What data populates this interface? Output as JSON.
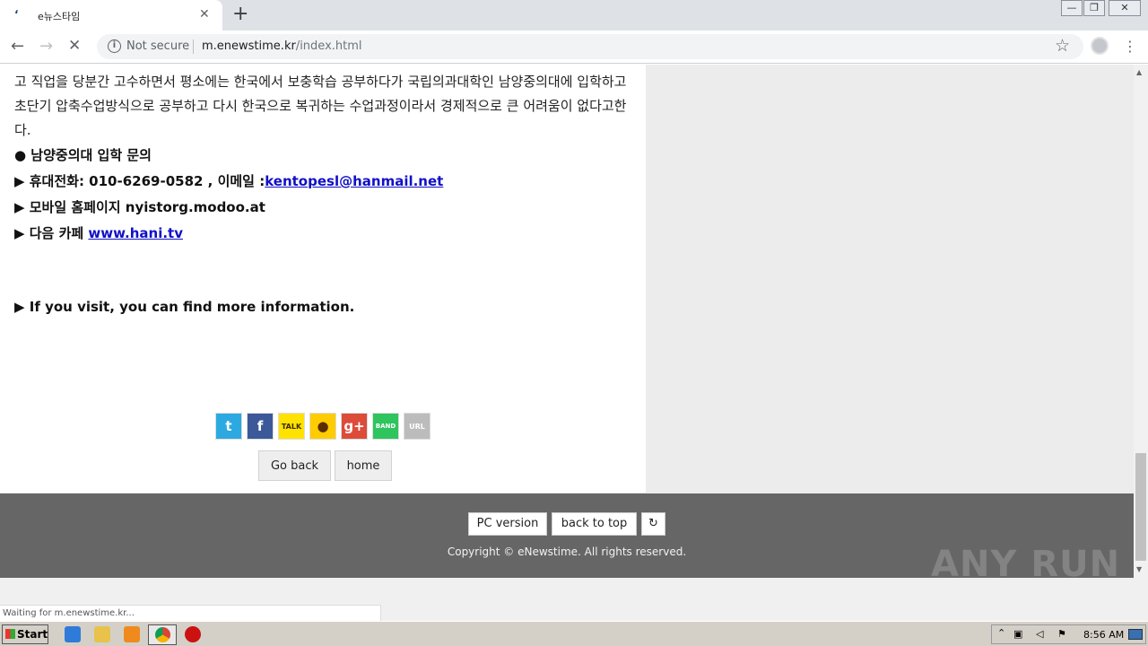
{
  "browser": {
    "tab_title": "e뉴스타임",
    "tab_close": "✕",
    "new_tab": "+",
    "security_label": "Not secure",
    "url_host": "m.enewstime.kr",
    "url_path": "/index.html",
    "window_controls": [
      "—",
      "❐",
      "✕"
    ]
  },
  "article": {
    "paragraph": "고 직업을 당분간 고수하면서 평소에는 한국에서 보충학습 공부하다가 국립의과대학인 남양중의대에 입학하고 초단기 압축수업방식으로 공부하고 다시 한국으로 복귀하는 수업과정이라서 경제적으로 큰 어려움이 없다고한다.",
    "heading": "● 남양중의대 입학 문의",
    "phone_line": "▶ 휴대전화: 010-6269-0582 , 이메일 :",
    "email": "kentopesl@hanmail.net",
    "mobile_line": "▶ 모바일 홈페이지 nyistorg.modoo.at",
    "cafe_label": "▶ 다음 카페 ",
    "cafe_link": "www.hani.tv",
    "visit_line": "▶ If you visit, you can find more information."
  },
  "share_icons": [
    {
      "name": "twitter-icon",
      "glyph": "t",
      "color": "#2ca9e1"
    },
    {
      "name": "facebook-icon",
      "glyph": "f",
      "color": "#3b5998"
    },
    {
      "name": "kakaotalk-icon",
      "glyph": "TALK",
      "color": "#ffe200"
    },
    {
      "name": "kakaostory-icon",
      "glyph": "●",
      "color": "#ffcc00"
    },
    {
      "name": "googleplus-icon",
      "glyph": "g+",
      "color": "#dd4b39"
    },
    {
      "name": "band-icon",
      "glyph": "BAND",
      "color": "#2ec45e"
    },
    {
      "name": "url-copy-icon",
      "glyph": "URL",
      "color": "#bcbcbc"
    }
  ],
  "buttons": {
    "go_back": "Go back",
    "home": "home",
    "pc_version": "PC version",
    "back_to_top": "back to top",
    "refresh": "↻"
  },
  "footer": {
    "copyright": "Copyright © eNewstime. All rights reserved."
  },
  "status_text": "Waiting for m.enewstime.kr...",
  "watermark": "ANY RUN",
  "taskbar": {
    "start_label": "Start",
    "clock": "8:56 AM"
  }
}
